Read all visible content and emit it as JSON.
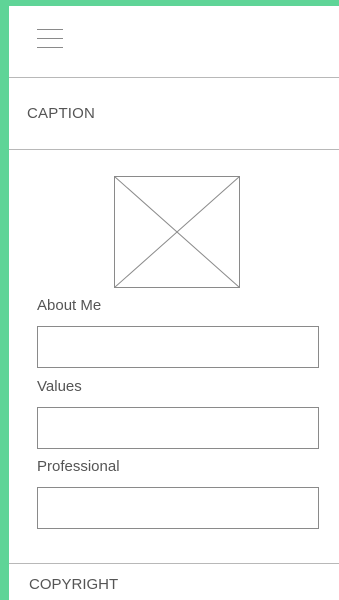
{
  "header": {
    "menu_icon": "hamburger-menu-icon"
  },
  "caption": {
    "text": "CAPTION"
  },
  "image": {
    "icon": "image-placeholder-icon"
  },
  "form": {
    "fields": [
      {
        "label": "About Me",
        "value": ""
      },
      {
        "label": "Values",
        "value": ""
      },
      {
        "label": "Professional",
        "value": ""
      }
    ]
  },
  "footer": {
    "text": "COPYRIGHT"
  },
  "colors": {
    "frame_background": "#5fd497",
    "page_background": "#ffffff",
    "divider": "#b8b8b8",
    "text": "#555555",
    "border": "#8a8a8a"
  }
}
